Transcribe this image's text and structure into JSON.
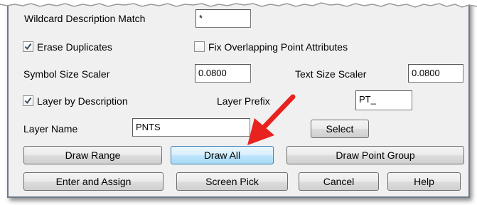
{
  "dialog": {
    "wildcard_label": "Wildcard Description Match",
    "wildcard_value": "*",
    "erase_duplicates_label": "Erase Duplicates",
    "erase_duplicates_checked": true,
    "fix_overlapping_label": "Fix Overlapping Point Attributes",
    "fix_overlapping_checked": false,
    "symbol_size_label": "Symbol Size Scaler",
    "symbol_size_value": "0.0800",
    "text_size_label": "Text Size Scaler",
    "text_size_value": "0.0800",
    "layer_by_description_label": "Layer by Description",
    "layer_by_description_checked": true,
    "layer_prefix_label": "Layer Prefix",
    "layer_prefix_value": "PT_",
    "layer_name_label": "Layer Name",
    "layer_name_value": "PNTS"
  },
  "buttons": {
    "select": "Select",
    "draw_range": "Draw Range",
    "draw_all": "Draw All",
    "draw_point_group": "Draw Point Group",
    "enter_and_assign": "Enter and Assign",
    "screen_pick": "Screen Pick",
    "cancel": "Cancel",
    "help": "Help"
  },
  "colors": {
    "annotation_arrow": "#e8231f",
    "panel_background": "#f0f0f0",
    "focused_button_border": "#3c7fb1"
  },
  "icons": {
    "checkmark": "checkmark-icon",
    "annotation_arrow": "red-arrow-annotation"
  }
}
